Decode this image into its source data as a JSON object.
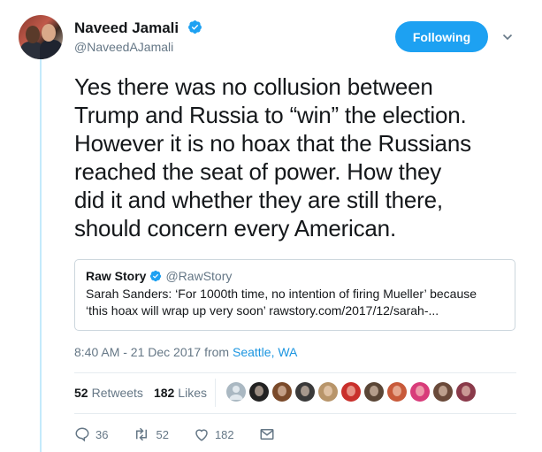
{
  "author": {
    "name": "Naveed Jamali",
    "handle": "@NaveedAJamali",
    "verified": true
  },
  "follow_button": "Following",
  "tweet_lines": [
    "Yes there was no collusion between",
    "Trump and Russia to “win” the election.",
    "However it is no hoax that the Russians",
    "reached the seat of power. How they",
    "did it and whether they are still there,",
    "should concern every American."
  ],
  "quoted": {
    "name": "Raw Story",
    "handle": "@RawStory",
    "verified": true,
    "text_lines": [
      "Sarah Sanders: ‘For 1000th time, no intention of firing Mueller’ because",
      "‘this hoax will wrap up very soon’ rawstory.com/2017/12/sarah-..."
    ]
  },
  "meta": {
    "timestamp": "8:40 AM - 21 Dec 2017 from ",
    "location": "Seattle, WA"
  },
  "stats": {
    "retweets_count": "52",
    "retweets_label": "Retweets",
    "likes_count": "182",
    "likes_label": "Likes"
  },
  "liker_avatars": [
    {
      "icon": "default-avatar",
      "color": "#aab8c2"
    },
    {
      "icon": "avatar",
      "color": "#222222"
    },
    {
      "icon": "avatar",
      "color": "#7a4a2a"
    },
    {
      "icon": "avatar",
      "color": "#3a3a3a"
    },
    {
      "icon": "avatar",
      "color": "#b8956a"
    },
    {
      "icon": "avatar",
      "color": "#c9302c"
    },
    {
      "icon": "avatar",
      "color": "#5a4636"
    },
    {
      "icon": "avatar",
      "color": "#c85a3a"
    },
    {
      "icon": "avatar",
      "color": "#d83c7a"
    },
    {
      "icon": "avatar",
      "color": "#6a4a3a"
    },
    {
      "icon": "avatar",
      "color": "#8a3a4a"
    }
  ],
  "actions": {
    "reply_count": "36",
    "retweet_count": "52",
    "like_count": "182"
  },
  "colors": {
    "accent": "#1da1f2",
    "link": "#1b95e0",
    "muted": "#657786",
    "thread": "#c4eafb"
  }
}
